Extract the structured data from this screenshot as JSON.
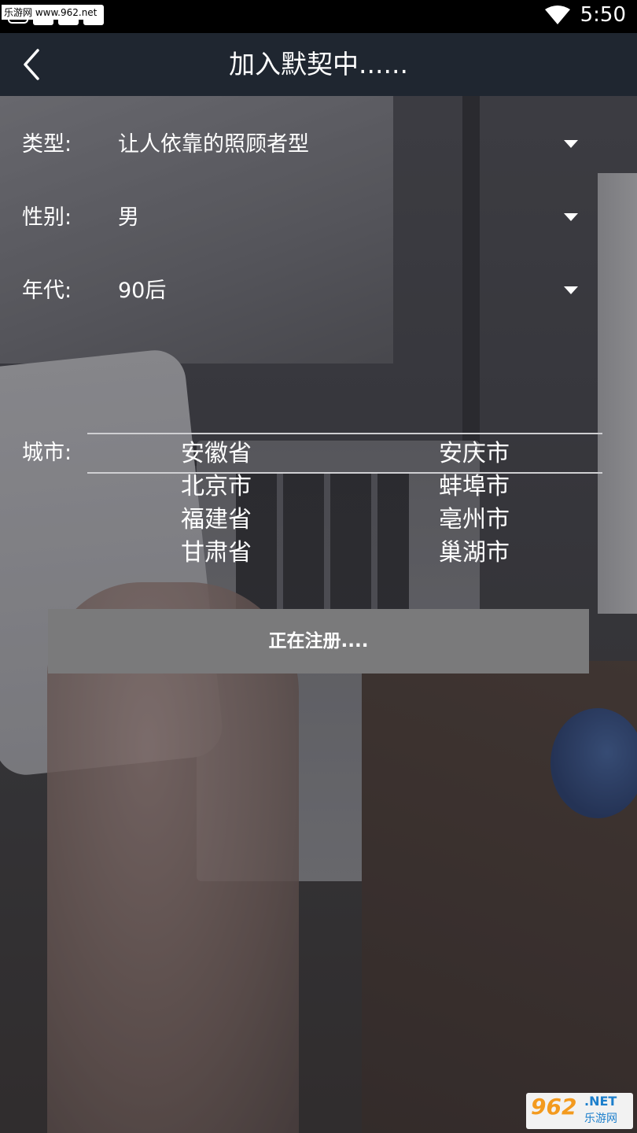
{
  "status_bar": {
    "watermark": "乐游网 www.962.net",
    "time": "5:50"
  },
  "header": {
    "title": "加入默契中......"
  },
  "form": {
    "type": {
      "label": "类型:",
      "value": "让人依靠的照顾者型"
    },
    "gender": {
      "label": "性别:",
      "value": "男"
    },
    "era": {
      "label": "年代:",
      "value": "90后"
    },
    "city": {
      "label": "城市:",
      "provinces": [
        "安徽省",
        "北京市",
        "福建省",
        "甘肃省"
      ],
      "cities": [
        "安庆市",
        "蚌埠市",
        "亳州市",
        "巢湖市"
      ]
    }
  },
  "register_button": {
    "label": "正在注册...."
  },
  "watermark_logo": {
    "number": "962",
    "net": ".NET",
    "cn": "乐游网"
  }
}
